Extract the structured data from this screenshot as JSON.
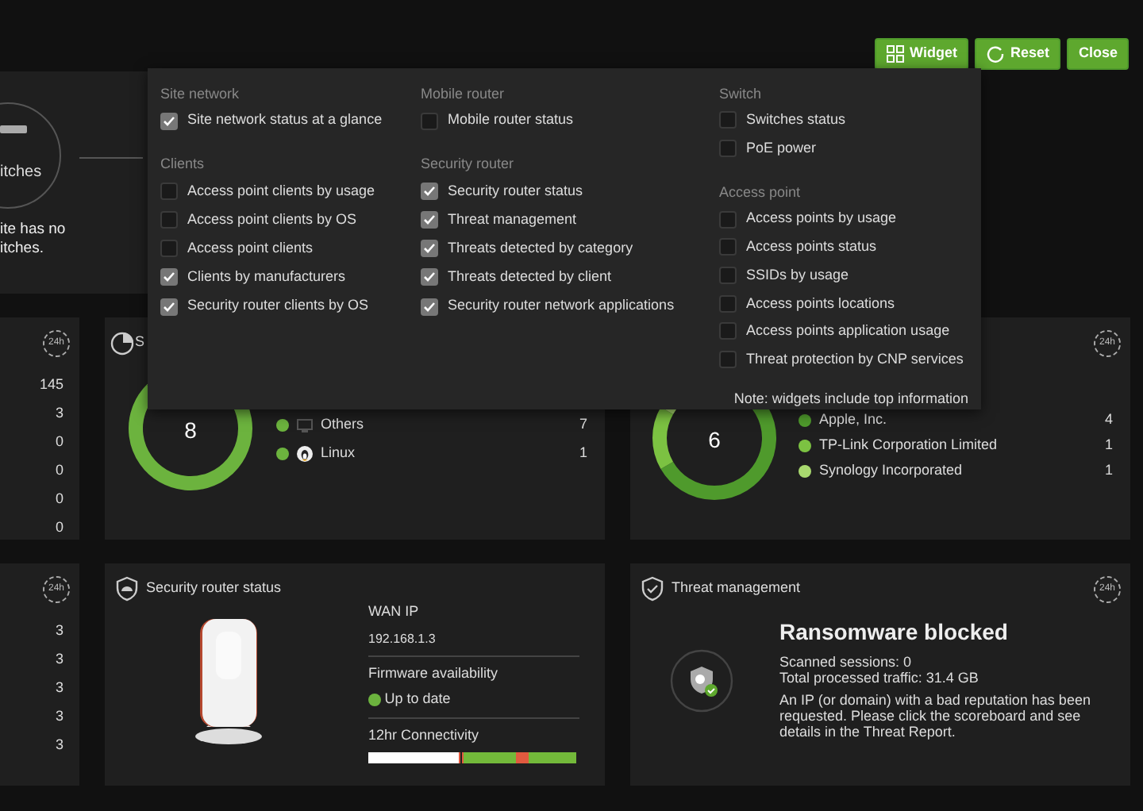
{
  "toolbar": {
    "buttons": [
      {
        "label": "Widget",
        "kind": "widget"
      },
      {
        "label": "Reset",
        "kind": "reset"
      },
      {
        "label": "Close",
        "kind": "close"
      }
    ]
  },
  "switches_card": {
    "label": "itches",
    "message": [
      "ite has no",
      "itches."
    ]
  },
  "summary_card": {
    "badge": "24h",
    "values": [
      "145",
      "3",
      "0",
      "0",
      "0",
      "0"
    ]
  },
  "os_card": {
    "title": "S",
    "total": "8",
    "items": [
      {
        "name": "Others",
        "count": "7",
        "color": "#6cb33e",
        "kind": "others"
      },
      {
        "name": "Linux",
        "count": "1",
        "color": "#6cb33e",
        "kind": "linux"
      }
    ]
  },
  "manufacturer_card": {
    "badge": "24h",
    "total": "6",
    "items": [
      {
        "name": "Apple, Inc.",
        "count": "4",
        "color": "#4f9a2c"
      },
      {
        "name": "TP-Link Corporation Limited",
        "count": "1",
        "color": "#7cc242"
      },
      {
        "name": "Synology Incorporated",
        "count": "1",
        "color": "#a9d96f"
      }
    ]
  },
  "summary_card_2": {
    "badge": "24h",
    "values": [
      "3",
      "3",
      "3",
      "3",
      "3"
    ]
  },
  "router_card": {
    "title": "Security router status",
    "wan_label": "WAN IP",
    "wan_ip": "192.168.1.3",
    "firmware_label": "Firmware availability",
    "firmware_status": "Up to date",
    "connectivity_label": "12hr Connectivity"
  },
  "threat_card": {
    "title": "Threat management",
    "badge": "24h",
    "headline": "Ransomware blocked",
    "sessions": "Scanned sessions: 0",
    "traffic": "Total processed traffic: 31.4 GB",
    "message": "An IP (or domain) with a bad reputation has been requested. Please click the scoreboard and see details in the Threat Report."
  },
  "widget_menu": {
    "columns": [
      [
        {
          "heading": "Site network",
          "items": [
            {
              "label": "Site network status at a glance",
              "checked": true
            }
          ]
        },
        {
          "heading": "Clients",
          "items": [
            {
              "label": "Access point clients by usage",
              "checked": false
            },
            {
              "label": "Access point clients by OS",
              "checked": false
            },
            {
              "label": "Access point clients",
              "checked": false
            },
            {
              "label": "Clients by manufacturers",
              "checked": true
            },
            {
              "label": "Security router clients by OS",
              "checked": true
            }
          ]
        }
      ],
      [
        {
          "heading": "Mobile router",
          "items": [
            {
              "label": "Mobile router status",
              "checked": false
            }
          ]
        },
        {
          "heading": "Security router",
          "items": [
            {
              "label": "Security router status",
              "checked": true
            },
            {
              "label": "Threat management",
              "checked": true
            },
            {
              "label": "Threats detected by category",
              "checked": true
            },
            {
              "label": "Threats detected by client",
              "checked": true
            },
            {
              "label": "Security router network applications",
              "checked": true
            }
          ]
        }
      ],
      [
        {
          "heading": "Switch",
          "items": [
            {
              "label": "Switches status",
              "checked": false
            },
            {
              "label": "PoE power",
              "checked": false
            }
          ]
        },
        {
          "heading": "Access point",
          "items": [
            {
              "label": "Access points by usage",
              "checked": false
            },
            {
              "label": "Access points status",
              "checked": false
            },
            {
              "label": "SSIDs by usage",
              "checked": false
            },
            {
              "label": "Access points locations",
              "checked": false
            },
            {
              "label": "Access points application usage",
              "checked": false
            },
            {
              "label": "Threat protection by CNP services",
              "checked": false
            }
          ]
        }
      ]
    ],
    "note": "Note: widgets include top information"
  }
}
